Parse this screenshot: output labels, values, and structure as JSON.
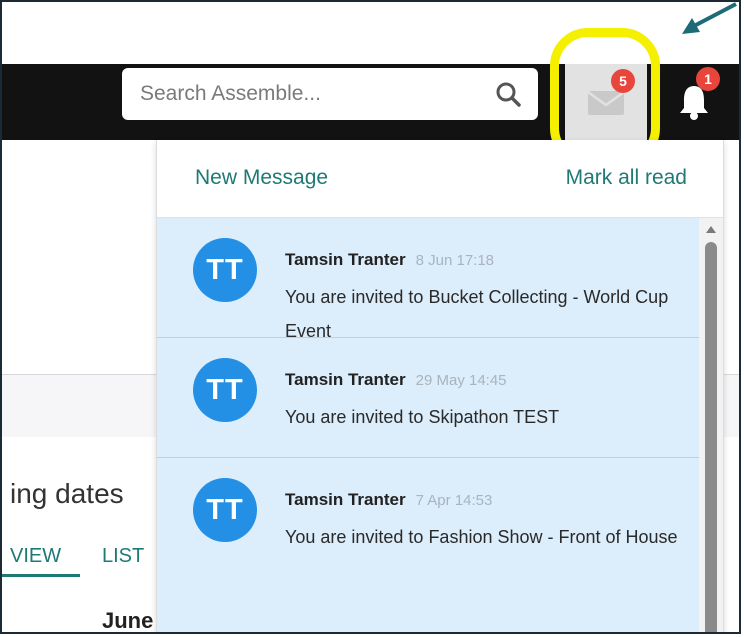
{
  "search": {
    "placeholder": "Search Assemble..."
  },
  "header": {
    "mail_badge": "5",
    "bell_badge": "1"
  },
  "background": {
    "dates_partial": "ing dates",
    "view_tab_partial": "VIEW",
    "list_tab_partial": "LIST",
    "month_partial": "June"
  },
  "panel": {
    "new_message": "New Message",
    "mark_all_read": "Mark all read",
    "messages": [
      {
        "initials": "TT",
        "sender": "Tamsin Tranter",
        "time": "8 Jun 17:18",
        "text": "You are invited to Bucket Collecting - World Cup Event"
      },
      {
        "initials": "TT",
        "sender": "Tamsin Tranter",
        "time": "29 May 14:45",
        "text": "You are invited to Skipathon TEST"
      },
      {
        "initials": "TT",
        "sender": "Tamsin Tranter",
        "time": "7 Apr 14:53",
        "text": "You are invited to Fashion Show - Front of House"
      }
    ]
  },
  "colors": {
    "accent": "#1e7a74",
    "avatar": "#2390e6",
    "badge": "#e8453c",
    "highlight": "#f5f000",
    "list_bg": "#dcedfb"
  }
}
